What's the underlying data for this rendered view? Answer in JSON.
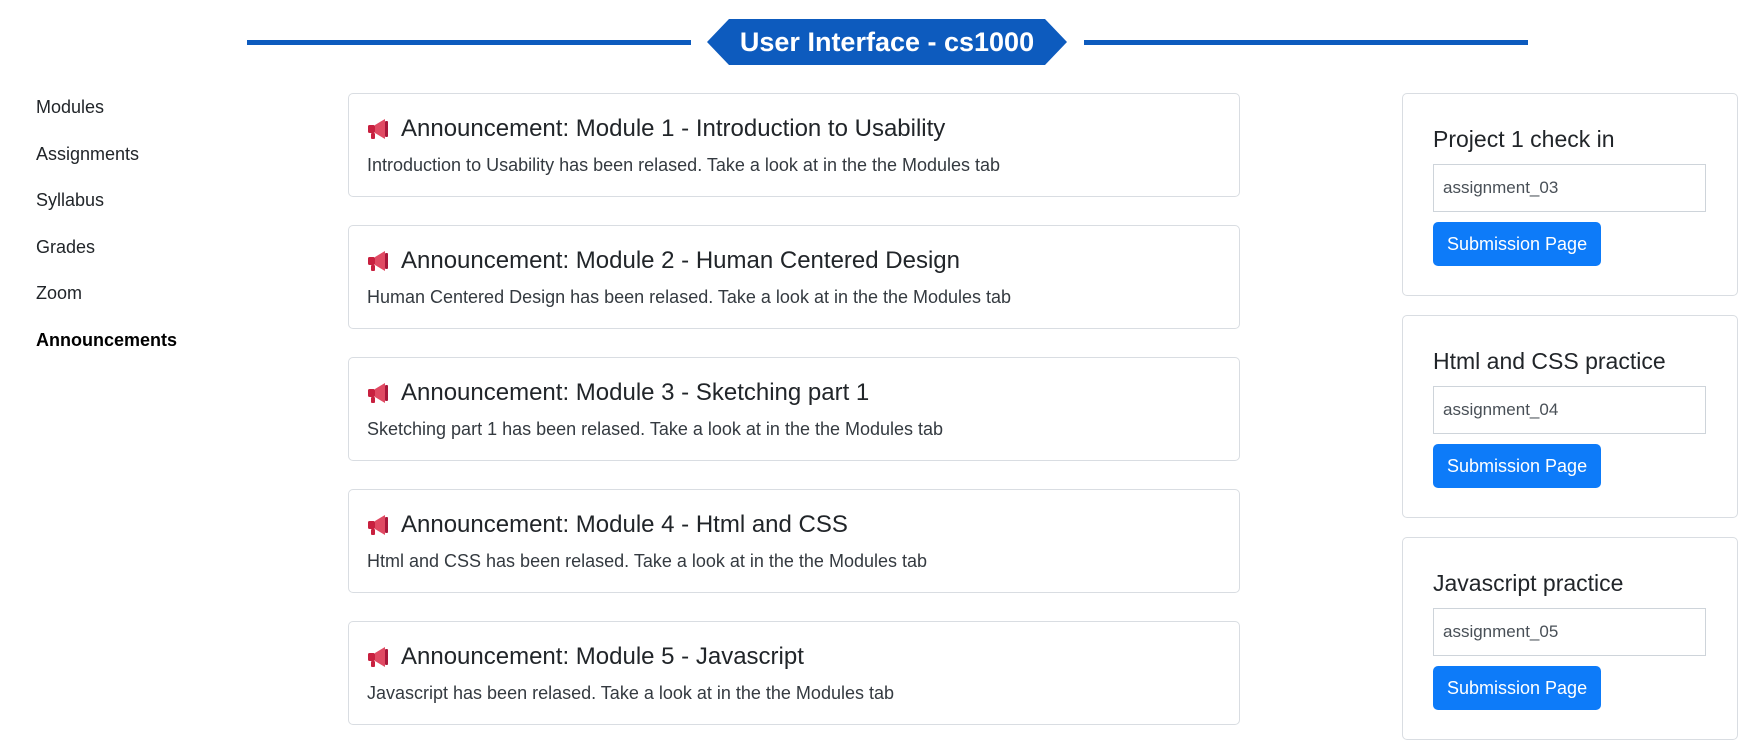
{
  "header": {
    "title": "User Interface - cs1000"
  },
  "sidebar": {
    "items": [
      {
        "label": "Modules"
      },
      {
        "label": "Assignments"
      },
      {
        "label": "Syllabus"
      },
      {
        "label": "Grades"
      },
      {
        "label": "Zoom"
      },
      {
        "label": "Announcements",
        "active": true
      }
    ]
  },
  "announcements": [
    {
      "title": "Announcement: Module 1 - Introduction to Usability",
      "text": "Introduction to Usability has been relased. Take a look at in the the Modules tab",
      "icon": "megaphone-icon"
    },
    {
      "title": "Announcement: Module 2 - Human Centered Design",
      "text": "Human Centered Design has been relased. Take a look at in the the Modules tab",
      "icon": "megaphone-icon"
    },
    {
      "title": "Announcement: Module 3 - Sketching part 1",
      "text": "Sketching part 1 has been relased. Take a look at in the the Modules tab",
      "icon": "megaphone-icon"
    },
    {
      "title": "Announcement: Module 4 - Html and CSS",
      "text": "Html and CSS has been relased. Take a look at in the the Modules tab",
      "icon": "megaphone-icon"
    },
    {
      "title": "Announcement: Module 5 - Javascript",
      "text": "Javascript has been relased. Take a look at in the the Modules tab",
      "icon": "megaphone-icon"
    }
  ],
  "assignments": [
    {
      "title": "Project 1 check in",
      "value": "assignment_03",
      "button": "Submission Page"
    },
    {
      "title": "Html and CSS practice",
      "value": "assignment_04",
      "button": "Submission Page"
    },
    {
      "title": "Javascript practice",
      "value": "assignment_05",
      "button": "Submission Page"
    }
  ],
  "colors": {
    "brand": "#0d5bbe",
    "button": "#0d7bf9",
    "megaphone": "#c8203f"
  }
}
